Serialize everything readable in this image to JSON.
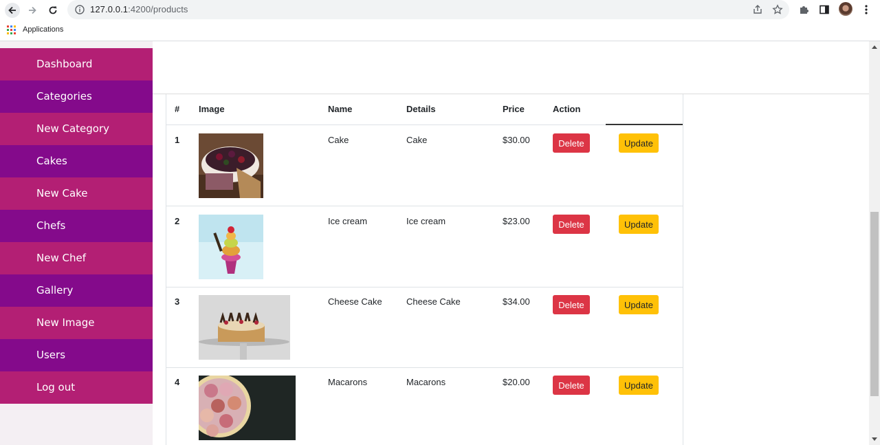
{
  "browser": {
    "url_host": "127.0.0.1",
    "url_rest": ":4200/products",
    "bookmark_apps_label": "Applications"
  },
  "sidebar": {
    "items": [
      {
        "label": "Dashboard"
      },
      {
        "label": "Categories"
      },
      {
        "label": "New Category"
      },
      {
        "label": "Cakes"
      },
      {
        "label": "New Cake"
      },
      {
        "label": "Chefs"
      },
      {
        "label": "New Chef"
      },
      {
        "label": "Gallery"
      },
      {
        "label": "New Image"
      },
      {
        "label": "Users"
      },
      {
        "label": "Log out"
      }
    ],
    "colors": {
      "pink": "#b31f74",
      "purple": "#840a8b"
    }
  },
  "table": {
    "headers": {
      "num": "#",
      "image": "Image",
      "name": "Name",
      "details": "Details",
      "price": "Price",
      "action": "Action"
    },
    "rows": [
      {
        "num": "1",
        "name": "Cake",
        "details": "Cake",
        "price": "$30.00",
        "delete": "Delete",
        "update": "Update",
        "image": "chocolate-berry-cake"
      },
      {
        "num": "2",
        "name": "Ice cream",
        "details": "Ice cream",
        "price": "$23.00",
        "delete": "Delete",
        "update": "Update",
        "image": "ice-cream-cup"
      },
      {
        "num": "3",
        "name": "Cheese Cake",
        "details": "Cheese Cake",
        "price": "$34.00",
        "delete": "Delete",
        "update": "Update",
        "image": "cheese-cake"
      },
      {
        "num": "4",
        "name": "Macarons",
        "details": "Macarons",
        "price": "$20.00",
        "delete": "Delete",
        "update": "Update",
        "image": "macarons-bowl"
      }
    ]
  },
  "colors": {
    "delete": "#dc3545",
    "update": "#ffc107"
  }
}
